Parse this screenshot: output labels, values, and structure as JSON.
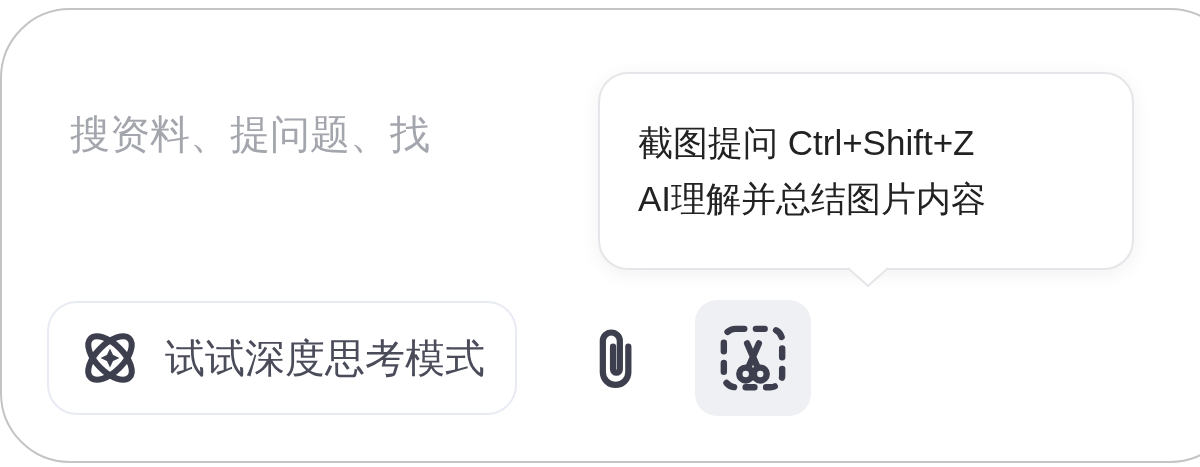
{
  "input": {
    "placeholder": "搜资料、提问题、找"
  },
  "tooltip": {
    "lines": [
      "截图提问 Ctrl+Shift+Z",
      "AI理解并总结图片内容"
    ]
  },
  "toolbar": [
    {
      "kind": "mode",
      "label": "试试深度思考模式"
    },
    {
      "kind": "attach",
      "highlighted": false
    },
    {
      "kind": "screenshot",
      "highlighted": true
    }
  ]
}
